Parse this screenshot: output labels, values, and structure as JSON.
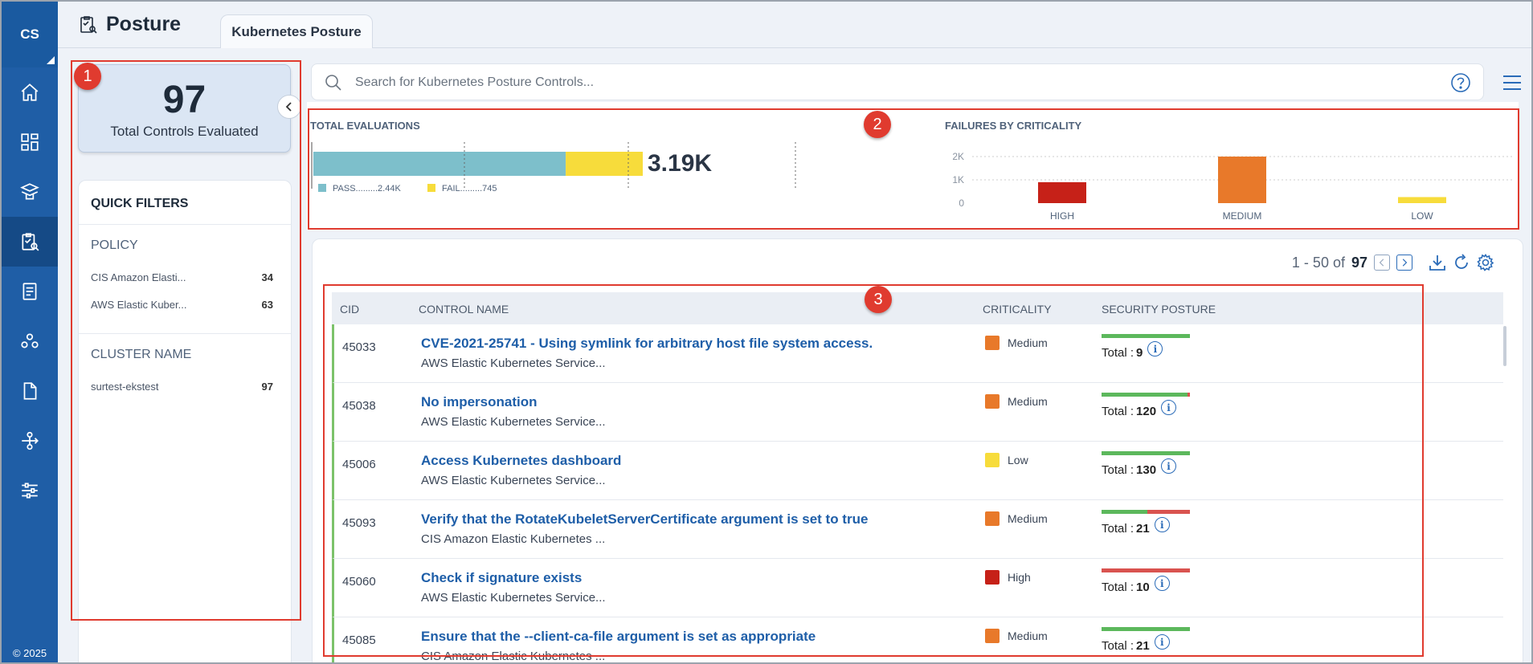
{
  "nav": {
    "brand": "CS",
    "copyright": "© 2025",
    "items": [
      {
        "icon": "home-icon"
      },
      {
        "icon": "dashboard-icon"
      },
      {
        "icon": "assets-icon"
      },
      {
        "icon": "posture-icon",
        "active": true
      },
      {
        "icon": "reports-icon"
      },
      {
        "icon": "users-icon"
      },
      {
        "icon": "document-icon"
      },
      {
        "icon": "connectors-icon"
      },
      {
        "icon": "settings-sliders-icon"
      }
    ]
  },
  "header": {
    "title": "Posture",
    "tab": "Kubernetes Posture"
  },
  "summary": {
    "count": "97",
    "label": "Total Controls Evaluated"
  },
  "filters": {
    "title": "QUICK FILTERS",
    "policy_label": "POLICY",
    "policy_items": [
      {
        "label": "CIS Amazon Elasti...",
        "count": "34"
      },
      {
        "label": "AWS Elastic Kuber...",
        "count": "63"
      }
    ],
    "cluster_label": "CLUSTER NAME",
    "cluster_items": [
      {
        "label": "surtest-ekstest",
        "count": "97"
      }
    ]
  },
  "search": {
    "placeholder": "Search for Kubernetes Posture Controls..."
  },
  "evaluations": {
    "title": "TOTAL EVALUATIONS",
    "total": "3.19K",
    "pass_label": "PASS.........2.44K",
    "fail_label": "FAIL.........745",
    "pass_value": 2440,
    "fail_value": 745,
    "pass_color": "#7dbfcb",
    "fail_color": "#f7dc3b"
  },
  "chart_data": {
    "type": "bar",
    "title": "FAILURES BY CRITICALITY",
    "categories": [
      "HIGH",
      "MEDIUM",
      "LOW"
    ],
    "values": [
      900,
      2000,
      260
    ],
    "colors": [
      "#c62118",
      "#e8792a",
      "#f7dc3b"
    ],
    "ytick_labels": [
      "2K",
      "1K",
      "0"
    ],
    "ylim": [
      0,
      2000
    ],
    "grid": true
  },
  "markers": [
    "1",
    "2",
    "3"
  ],
  "table": {
    "range": "1 - 50 of",
    "total": "97",
    "columns": {
      "cid": "CID",
      "name": "CONTROL NAME",
      "criticality": "CRITICALITY",
      "posture": "SECURITY POSTURE"
    },
    "rows": [
      {
        "cid": "45033",
        "name": "CVE-2021-25741 - Using symlink for arbitrary host file system access.",
        "policy": "AWS Elastic Kubernetes Service...",
        "criticality": "Medium",
        "crit_color": "#e8792a",
        "total_label": "Total :",
        "total": "9",
        "pass_fraction": 1.0
      },
      {
        "cid": "45038",
        "name": "No impersonation",
        "policy": "AWS Elastic Kubernetes Service...",
        "criticality": "Medium",
        "crit_color": "#e8792a",
        "total_label": "Total :",
        "total": "120",
        "pass_fraction": 0.97
      },
      {
        "cid": "45006",
        "name": "Access Kubernetes dashboard",
        "policy": "AWS Elastic Kubernetes Service...",
        "criticality": "Low",
        "crit_color": "#f7dc3b",
        "total_label": "Total :",
        "total": "130",
        "pass_fraction": 1.0
      },
      {
        "cid": "45093",
        "name": "Verify that the RotateKubeletServerCertificate argument is set to true",
        "policy": "CIS Amazon Elastic Kubernetes ...",
        "criticality": "Medium",
        "crit_color": "#e8792a",
        "total_label": "Total :",
        "total": "21",
        "pass_fraction": 0.52
      },
      {
        "cid": "45060",
        "name": "Check if signature exists",
        "policy": "AWS Elastic Kubernetes Service...",
        "criticality": "High",
        "crit_color": "#c62118",
        "total_label": "Total :",
        "total": "10",
        "pass_fraction": 0.0
      },
      {
        "cid": "45085",
        "name": "Ensure that the --client-ca-file argument is set as appropriate",
        "policy": "CIS Amazon Elastic Kubernetes ...",
        "criticality": "Medium",
        "crit_color": "#e8792a",
        "total_label": "Total :",
        "total": "21",
        "pass_fraction": 1.0
      }
    ]
  }
}
